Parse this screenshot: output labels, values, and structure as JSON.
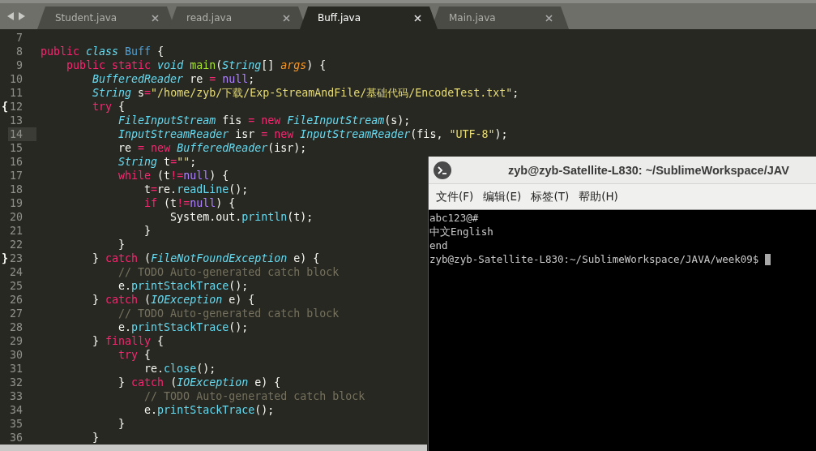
{
  "editor": {
    "tabs": [
      {
        "label": "Student.java",
        "selected": false
      },
      {
        "label": "read.java",
        "selected": false
      },
      {
        "label": "Buff.java",
        "selected": true
      },
      {
        "label": "Main.java",
        "selected": false
      }
    ],
    "lines": [
      {
        "number": "7",
        "current": false
      },
      {
        "number": "8",
        "current": false,
        "tokens": [
          {
            "kind": "kw",
            "text": "public"
          },
          {
            "kind": "storage",
            "text": " class"
          },
          {
            "kind": "cls",
            "text": " Buff"
          },
          {
            "kind": "plain",
            "text": " {"
          }
        ]
      },
      {
        "number": "9",
        "current": false,
        "tokens": [
          {
            "kind": "kw",
            "text": "    public"
          },
          {
            "kind": "kw",
            "text": " static"
          },
          {
            "kind": "storage",
            "text": " void"
          },
          {
            "kind": "fn",
            "text": " main"
          },
          {
            "kind": "plain",
            "text": "("
          },
          {
            "kind": "storage",
            "text": "String"
          },
          {
            "kind": "plain",
            "text": "[] "
          },
          {
            "kind": "param",
            "text": "args"
          },
          {
            "kind": "plain",
            "text": ") {"
          }
        ]
      },
      {
        "number": "10",
        "current": false,
        "tokens": [
          {
            "kind": "storage",
            "text": "        BufferedReader"
          },
          {
            "kind": "plain",
            "text": " re "
          },
          {
            "kind": "kw",
            "text": "="
          },
          {
            "kind": "const",
            "text": " null"
          },
          {
            "kind": "plain",
            "text": ";"
          }
        ]
      },
      {
        "number": "11",
        "current": false,
        "tokens": [
          {
            "kind": "storage",
            "text": "        String"
          },
          {
            "kind": "plain",
            "text": " s"
          },
          {
            "kind": "kw",
            "text": "="
          },
          {
            "kind": "str",
            "text": "\"/home/zyb/下载/Exp-StreamAndFile/基础代码/EncodeTest.txt\""
          },
          {
            "kind": "plain",
            "text": ";"
          }
        ]
      },
      {
        "number": "12",
        "fold": "{",
        "current": false,
        "tokens": [
          {
            "kind": "kw",
            "text": "        try"
          },
          {
            "kind": "plain",
            "text": " {"
          }
        ]
      },
      {
        "number": "13",
        "current": false,
        "tokens": [
          {
            "kind": "storage",
            "text": "            FileInputStream"
          },
          {
            "kind": "plain",
            "text": " fis "
          },
          {
            "kind": "kw",
            "text": "="
          },
          {
            "kind": "kw",
            "text": " new"
          },
          {
            "kind": "storage",
            "text": " FileInputStream"
          },
          {
            "kind": "plain",
            "text": "(s);"
          }
        ]
      },
      {
        "number": "14",
        "current": true,
        "tokens": [
          {
            "kind": "storage",
            "text": "            InputStreamReader"
          },
          {
            "kind": "plain",
            "text": " isr "
          },
          {
            "kind": "kw",
            "text": "="
          },
          {
            "kind": "kw",
            "text": " new"
          },
          {
            "kind": "storage",
            "text": " InputStreamReader"
          },
          {
            "kind": "plain",
            "text": "(fis, "
          },
          {
            "kind": "str",
            "text": "\"UTF-8\""
          },
          {
            "kind": "plain",
            "text": ");"
          }
        ]
      },
      {
        "number": "15",
        "current": false,
        "tokens": [
          {
            "kind": "plain",
            "text": "            re "
          },
          {
            "kind": "kw",
            "text": "="
          },
          {
            "kind": "kw",
            "text": " new"
          },
          {
            "kind": "storage",
            "text": " BufferedReader"
          },
          {
            "kind": "plain",
            "text": "(isr);"
          }
        ]
      },
      {
        "number": "16",
        "current": false,
        "tokens": [
          {
            "kind": "storage",
            "text": "            String"
          },
          {
            "kind": "plain",
            "text": " t"
          },
          {
            "kind": "kw",
            "text": "="
          },
          {
            "kind": "str",
            "text": "\"\""
          },
          {
            "kind": "plain",
            "text": ";"
          }
        ]
      },
      {
        "number": "17",
        "current": false,
        "tokens": [
          {
            "kind": "kw",
            "text": "            while"
          },
          {
            "kind": "plain",
            "text": " (t"
          },
          {
            "kind": "kw",
            "text": "!="
          },
          {
            "kind": "const",
            "text": "null"
          },
          {
            "kind": "plain",
            "text": ") {"
          }
        ]
      },
      {
        "number": "18",
        "current": false,
        "tokens": [
          {
            "kind": "plain",
            "text": "                t"
          },
          {
            "kind": "kw",
            "text": "="
          },
          {
            "kind": "plain",
            "text": "re."
          },
          {
            "kind": "call",
            "text": "readLine"
          },
          {
            "kind": "plain",
            "text": "();"
          }
        ]
      },
      {
        "number": "19",
        "current": false,
        "tokens": [
          {
            "kind": "kw",
            "text": "                if"
          },
          {
            "kind": "plain",
            "text": " (t"
          },
          {
            "kind": "kw",
            "text": "!="
          },
          {
            "kind": "const",
            "text": "null"
          },
          {
            "kind": "plain",
            "text": ") {"
          }
        ]
      },
      {
        "number": "20",
        "current": false,
        "tokens": [
          {
            "kind": "plain",
            "text": "                    System.out."
          },
          {
            "kind": "call",
            "text": "println"
          },
          {
            "kind": "plain",
            "text": "(t);"
          }
        ]
      },
      {
        "number": "21",
        "current": false,
        "tokens": [
          {
            "kind": "plain",
            "text": "                }"
          }
        ]
      },
      {
        "number": "22",
        "current": false,
        "tokens": [
          {
            "kind": "plain",
            "text": "            }"
          }
        ]
      },
      {
        "number": "23",
        "fold": "}",
        "current": false,
        "tokens": [
          {
            "kind": "plain",
            "text": "        }"
          },
          {
            "kind": "kw",
            "text": " catch"
          },
          {
            "kind": "plain",
            "text": " ("
          },
          {
            "kind": "storage",
            "text": "FileNotFoundException"
          },
          {
            "kind": "plain",
            "text": " e) {"
          }
        ]
      },
      {
        "number": "24",
        "current": false,
        "tokens": [
          {
            "kind": "comment",
            "text": "            // TODO Auto-generated catch block"
          }
        ]
      },
      {
        "number": "25",
        "current": false,
        "tokens": [
          {
            "kind": "plain",
            "text": "            e."
          },
          {
            "kind": "call",
            "text": "printStackTrace"
          },
          {
            "kind": "plain",
            "text": "();"
          }
        ]
      },
      {
        "number": "26",
        "current": false,
        "tokens": [
          {
            "kind": "plain",
            "text": "        }"
          },
          {
            "kind": "kw",
            "text": " catch"
          },
          {
            "kind": "plain",
            "text": " ("
          },
          {
            "kind": "storage",
            "text": "IOException"
          },
          {
            "kind": "plain",
            "text": " e) {"
          }
        ]
      },
      {
        "number": "27",
        "current": false,
        "tokens": [
          {
            "kind": "comment",
            "text": "            // TODO Auto-generated catch block"
          }
        ]
      },
      {
        "number": "28",
        "current": false,
        "tokens": [
          {
            "kind": "plain",
            "text": "            e."
          },
          {
            "kind": "call",
            "text": "printStackTrace"
          },
          {
            "kind": "plain",
            "text": "();"
          }
        ]
      },
      {
        "number": "29",
        "current": false,
        "tokens": [
          {
            "kind": "plain",
            "text": "        }"
          },
          {
            "kind": "kw",
            "text": " finally"
          },
          {
            "kind": "plain",
            "text": " {"
          }
        ]
      },
      {
        "number": "30",
        "current": false,
        "tokens": [
          {
            "kind": "kw",
            "text": "            try"
          },
          {
            "kind": "plain",
            "text": " {"
          }
        ]
      },
      {
        "number": "31",
        "current": false,
        "tokens": [
          {
            "kind": "plain",
            "text": "                re."
          },
          {
            "kind": "call",
            "text": "close"
          },
          {
            "kind": "plain",
            "text": "();"
          }
        ]
      },
      {
        "number": "32",
        "current": false,
        "tokens": [
          {
            "kind": "plain",
            "text": "            }"
          },
          {
            "kind": "kw",
            "text": " catch"
          },
          {
            "kind": "plain",
            "text": " ("
          },
          {
            "kind": "storage",
            "text": "IOException"
          },
          {
            "kind": "plain",
            "text": " e) {"
          }
        ]
      },
      {
        "number": "33",
        "current": false,
        "tokens": [
          {
            "kind": "comment",
            "text": "                // TODO Auto-generated catch block"
          }
        ]
      },
      {
        "number": "34",
        "current": false,
        "tokens": [
          {
            "kind": "plain",
            "text": "                e."
          },
          {
            "kind": "call",
            "text": "printStackTrace"
          },
          {
            "kind": "plain",
            "text": "();"
          }
        ]
      },
      {
        "number": "35",
        "current": false,
        "tokens": [
          {
            "kind": "plain",
            "text": "            }"
          }
        ]
      },
      {
        "number": "36",
        "current": false,
        "tokens": [
          {
            "kind": "plain",
            "text": "        }"
          }
        ]
      }
    ]
  },
  "terminal": {
    "title": "zyb@zyb-Satellite-L830: ~/SublimeWorkspace/JAV",
    "menu": [
      "文件(F)",
      "编辑(E)",
      "标签(T)",
      "帮助(H)"
    ],
    "output": [
      "abc123@#",
      "中文English",
      "end"
    ],
    "prompt": "zyb@zyb-Satellite-L830:~/SublimeWorkspace/JAVA/week09$"
  }
}
